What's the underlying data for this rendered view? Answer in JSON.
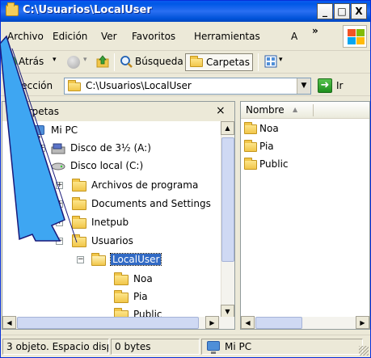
{
  "window": {
    "title": "C:\\Usuarios\\LocalUser",
    "min_glyph": "_",
    "max_glyph": "□",
    "close_glyph": "X"
  },
  "menu": {
    "items": [
      "Archivo",
      "Edición",
      "Ver",
      "Favoritos",
      "Herramientas",
      "A"
    ],
    "overflow": "»"
  },
  "toolbar": {
    "back_label": "Atrás",
    "search_label": "Búsqueda",
    "folders_label": "Carpetas",
    "back_dropdown": "▾",
    "forward_dropdown": "▾",
    "views_dropdown": "▾"
  },
  "address": {
    "label": "Dirección",
    "value": "C:\\Usuarios\\LocalUser",
    "go_label": "Ir"
  },
  "folders_pane": {
    "title": "Carpetas",
    "close": "×",
    "tree": [
      {
        "label": "Mi PC",
        "icon": "computer-icon"
      },
      {
        "label": "Disco de 3½ (A:)",
        "icon": "floppy-icon",
        "toggle": "+"
      },
      {
        "label": "Disco local (C:)",
        "icon": "drive-icon",
        "toggle": "−"
      },
      {
        "label": "Archivos de programa",
        "icon": "folder-icon",
        "toggle": "+"
      },
      {
        "label": "Documents and Settings",
        "icon": "folder-icon",
        "toggle": "+"
      },
      {
        "label": "Inetpub",
        "icon": "folder-icon",
        "toggle": "+"
      },
      {
        "label": "Usuarios",
        "icon": "folder-icon",
        "toggle": "−"
      },
      {
        "label": "LocalUser",
        "icon": "folder-open-icon",
        "toggle": "−",
        "selected": true
      },
      {
        "label": "Noa",
        "icon": "folder-icon"
      },
      {
        "label": "Pia",
        "icon": "folder-icon"
      },
      {
        "label": "Public",
        "icon": "folder-icon"
      }
    ]
  },
  "contents_pane": {
    "column": "Nombre",
    "sort_glyph": "▲",
    "items": [
      "Noa",
      "Pia",
      "Public"
    ]
  },
  "status": {
    "objects": "3 objeto. Espacio disp",
    "size": "0 bytes",
    "location": "Mi PC"
  },
  "colors": {
    "title_bar": "#0058e6",
    "pointer_fill": "#3ea6f2",
    "pointer_stroke": "#1a1a7a",
    "selection": "#316ac5"
  }
}
